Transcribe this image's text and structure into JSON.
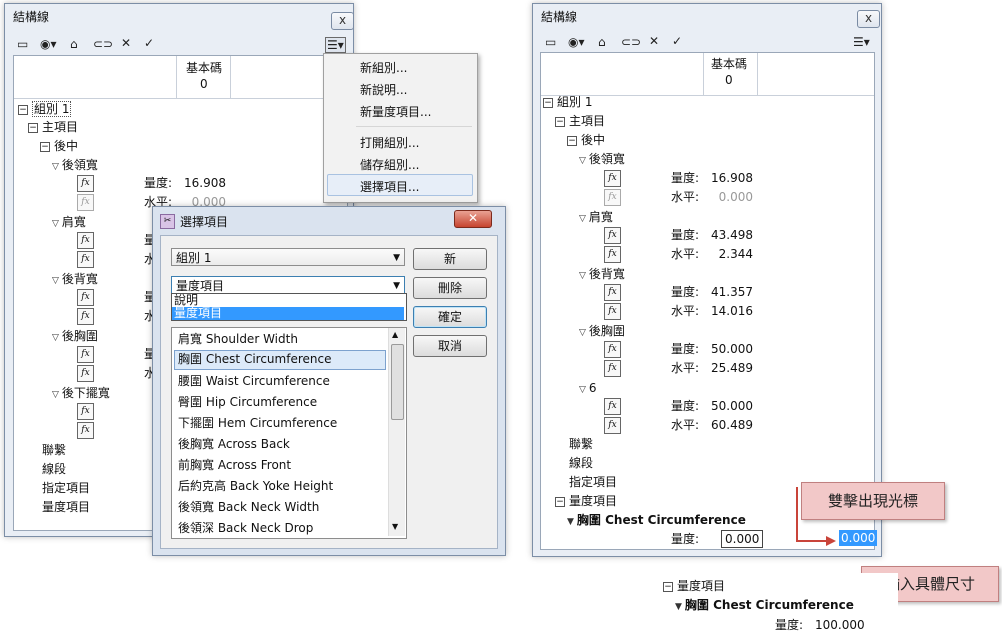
{
  "left_window": {
    "title": "結構線",
    "close": "x",
    "header": {
      "label": "基本碼",
      "value": "0"
    },
    "tree": [
      {
        "label": "組別 1",
        "toggle": "⊟"
      },
      {
        "label": "主項目",
        "toggle": "⊟"
      },
      {
        "label": "後中",
        "toggle": "⊟"
      },
      {
        "label": "後領寬"
      },
      {
        "label": "肩寬"
      },
      {
        "label": "後背寬"
      },
      {
        "label": "後胸圍"
      },
      {
        "label": "後下擺寬"
      },
      {
        "label": "聯繫"
      },
      {
        "label": "線段"
      },
      {
        "label": "指定項目"
      },
      {
        "label": "量度項目"
      }
    ],
    "measure_label": "量度:",
    "level_label": "水平:",
    "partial_label": "量",
    "partial_label2": "水",
    "first_measure": "16.908",
    "first_level": "0.000"
  },
  "context_menu": {
    "items": [
      "新組別...",
      "新說明...",
      "新量度項目...",
      "打開組別...",
      "儲存組別...",
      "選擇項目..."
    ],
    "highlighted": "選擇項目..."
  },
  "dialog": {
    "title": "選擇項目",
    "group_combo": "組別 1",
    "type_combo": "量度項目",
    "dropdown_options": [
      "說明",
      "量度項目"
    ],
    "buttons": [
      "新",
      "刪除",
      "確定",
      "取消"
    ],
    "list": [
      "肩寬 Shoulder Width",
      "胸圍 Chest Circumference",
      "腰圍 Waist Circumference",
      "臀圍 Hip Circumference",
      "下擺圍 Hem Circumference",
      "後胸寬 Across Back",
      "前胸寬 Across Front",
      "后約克高 Back Yoke Height",
      "後領寬 Back Neck Width",
      "後領深 Back Neck Drop"
    ],
    "selected": "胸圍 Chest Circumference"
  },
  "right_window": {
    "title": "結構線",
    "close": "x",
    "header": {
      "label": "基本碼",
      "value": "0"
    },
    "group": "組別 1",
    "main": "主項目",
    "back_center": "後中",
    "sections": [
      {
        "label": "後領寬",
        "measure": "16.908",
        "level": "0.000"
      },
      {
        "label": "肩寬",
        "measure": "43.498",
        "level": "2.344"
      },
      {
        "label": "後背寬",
        "measure": "41.357",
        "level": "14.016"
      },
      {
        "label": "後胸圍",
        "measure": "50.000",
        "level": "25.489"
      },
      {
        "label": "6",
        "measure": "50.000",
        "level": "60.489"
      }
    ],
    "measure_label": "量度:",
    "level_label": "水平:",
    "footer_items": [
      "聯繫",
      "線段",
      "指定項目",
      "量度項目"
    ],
    "chest": "胸圍 Chest Circumference",
    "chest_measure": "0.000",
    "chest_selected": "0.000"
  },
  "callouts": {
    "double_click": "雙擊出現光標",
    "enter_size": "輸入具體尺寸"
  },
  "bottom_snippet": {
    "item": "量度項目",
    "chest": "胸圍 Chest Circumference",
    "label": "量度:",
    "value": "100.000"
  },
  "colors": {
    "accent_red": "#c9443a",
    "select_blue": "#3399ff",
    "callout_bg": "#f2c8c8"
  }
}
